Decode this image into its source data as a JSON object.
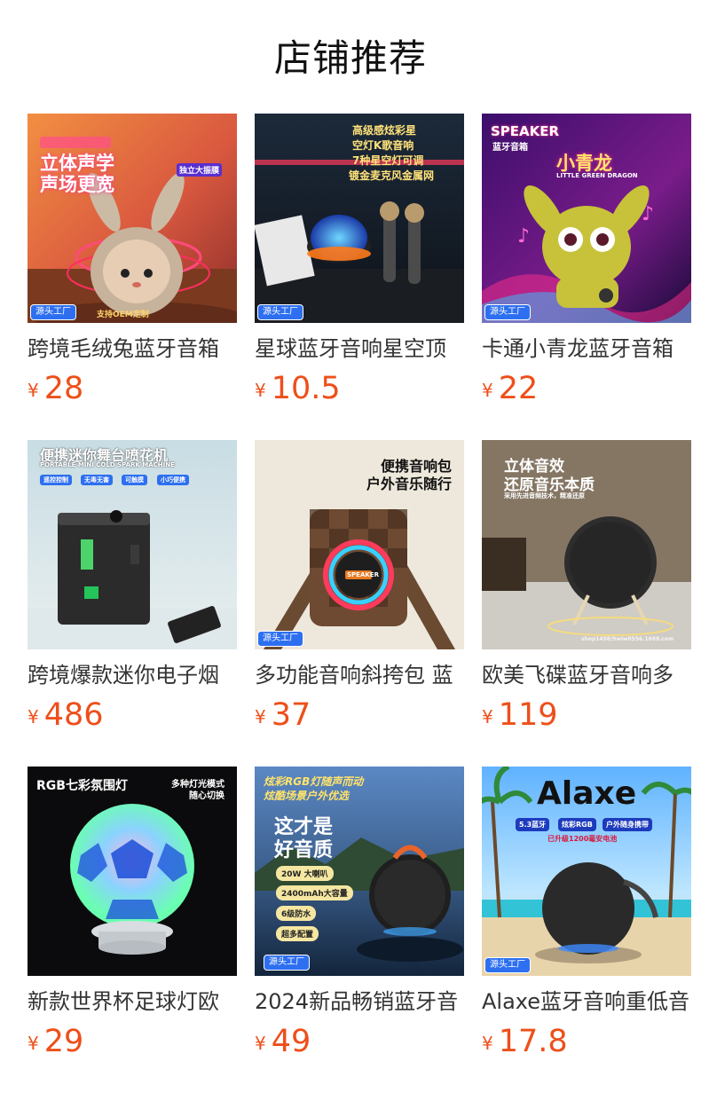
{
  "header": {
    "title": "店铺推荐"
  },
  "products": [
    {
      "name": "跨境毛绒兔蓝牙音箱",
      "currency": "¥",
      "price": "28",
      "badge": "源头工厂",
      "image_text": [
        "立体声学",
        "声场更宽",
        "独立大振膜",
        "支持OEM定制"
      ],
      "image_icon": "plush-bunny-speaker"
    },
    {
      "name": "星球蓝牙音响星空顶",
      "currency": "¥",
      "price": "10.5",
      "badge": "源头工厂",
      "image_text": [
        "高级感炫彩星",
        "空灯K歌音响",
        "7种星空灯可调",
        "镀金麦克风金属网"
      ],
      "image_icon": "planet-speaker-with-microphones"
    },
    {
      "name": "卡通小青龙蓝牙音箱",
      "currency": "¥",
      "price": "22",
      "badge": "源头工厂",
      "image_text": [
        "SPEAKER",
        "蓝牙音箱",
        "小青龙",
        "LITTLE GREEN DRAGON"
      ],
      "image_icon": "cartoon-dragon-speaker"
    },
    {
      "name": "跨境爆款迷你电子烟",
      "currency": "¥",
      "price": "486",
      "badge": "",
      "image_text": [
        "便携迷你舞台喷花机",
        "PORTABLE MINI COLD SPARK MACHINE",
        "遥控控制",
        "无毒无害",
        "可触摸",
        "小巧便携"
      ],
      "image_icon": "mini-spark-machine"
    },
    {
      "name": "多功能音响斜挎包 蓝",
      "currency": "¥",
      "price": "37",
      "badge": "源头工厂",
      "image_text": [
        "便携音响包",
        "户外音乐随行",
        "SPEAKER"
      ],
      "image_icon": "crossbody-bag-speaker"
    },
    {
      "name": "欧美飞碟蓝牙音响多",
      "currency": "¥",
      "price": "119",
      "badge": "",
      "image_text": [
        "立体音效",
        "还原音乐本质",
        "采用先进音频技术，精准还原",
        "shop1498/9wiw8556.1688.com"
      ],
      "image_icon": "disc-speaker-on-stand"
    },
    {
      "name": "新款世界杯足球灯欧",
      "currency": "¥",
      "price": "29",
      "badge": "",
      "image_text": [
        "RGB七彩氛围灯",
        "多种灯光模式",
        "随心切换"
      ],
      "image_icon": "football-lamp"
    },
    {
      "name": "2024新品畅销蓝牙音",
      "currency": "¥",
      "price": "49",
      "badge": "源头工厂",
      "image_text": [
        "炫彩RGB灯随声而动",
        "炫酷场景户外优选",
        "这才是",
        "好音质",
        "20W 大喇叭",
        "2400mAh大容量",
        "6级防水",
        "超多配置"
      ],
      "image_icon": "round-speaker-lake"
    },
    {
      "name": "Alaxe蓝牙音响重低音",
      "currency": "¥",
      "price": "17.8",
      "badge": "源头工厂",
      "image_text": [
        "Alaxe",
        "5.3蓝牙",
        "炫彩RGB",
        "户外随身携带",
        "已升级1200毫安电池"
      ],
      "image_icon": "beach-round-speaker"
    }
  ]
}
